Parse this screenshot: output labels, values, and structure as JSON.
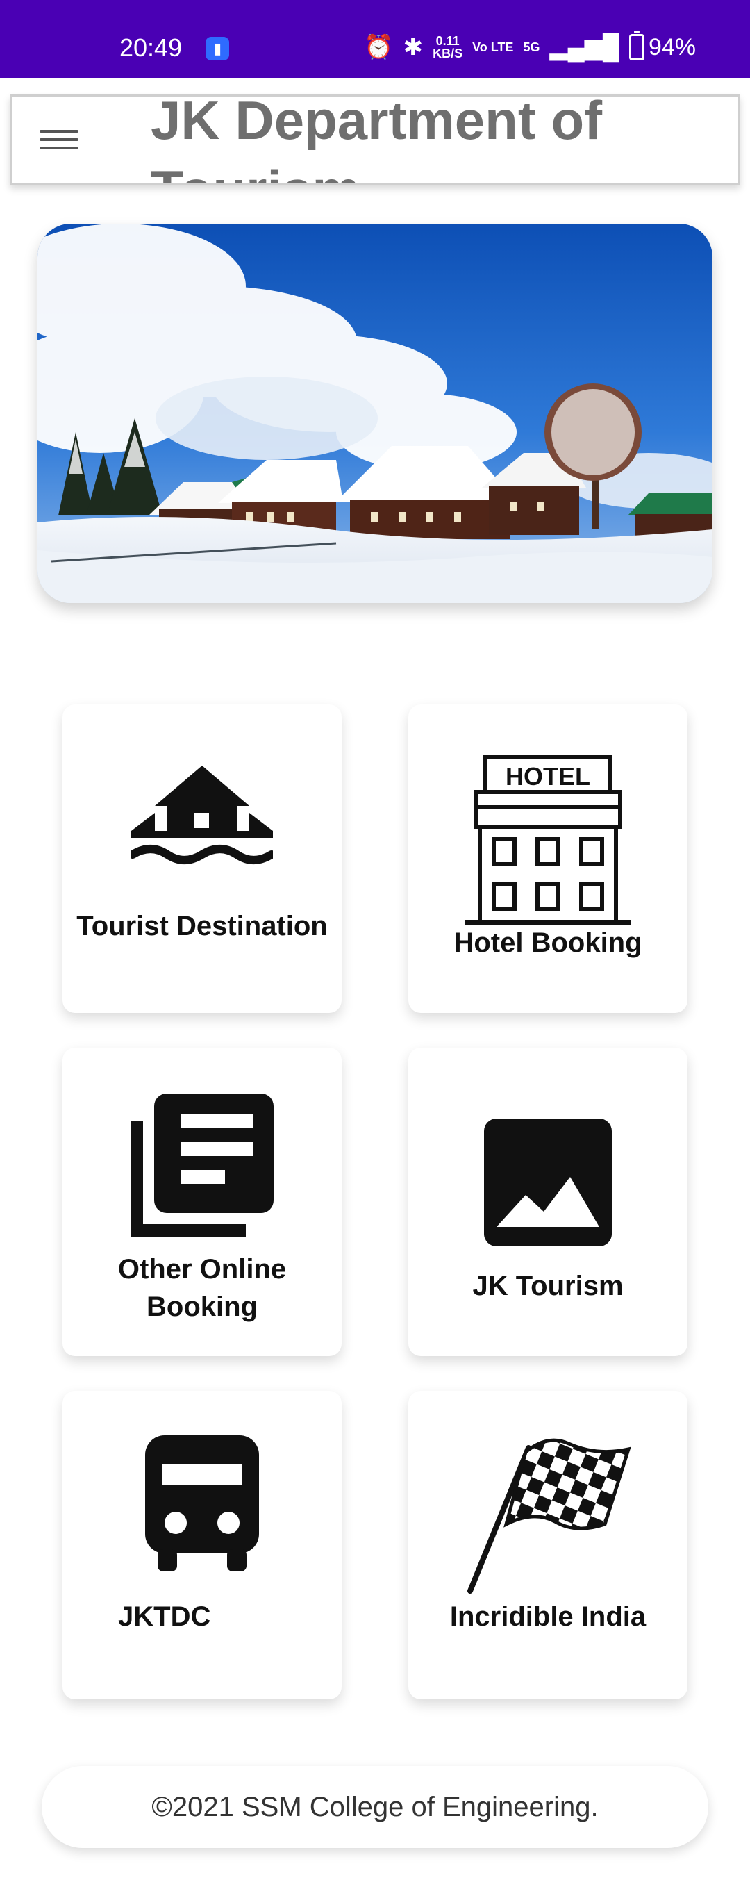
{
  "status_bar": {
    "time": "20:49",
    "network_speed_value": "0.11",
    "network_speed_unit": "KB/S",
    "volte": "Vo LTE",
    "network": "5G",
    "battery": "94%",
    "icons": [
      "app-notification-icon",
      "alarm-icon",
      "bluetooth-icon",
      "signal-icon",
      "battery-icon"
    ]
  },
  "header": {
    "title": "JK Department of Tourism",
    "menu_icon": "menu-icon"
  },
  "hero": {
    "image": "snowy-cabins-landscape"
  },
  "cards": [
    {
      "label": "Tourist Destination",
      "icon": "house-on-water-icon"
    },
    {
      "label": "Hotel Booking",
      "icon": "hotel-icon",
      "icon_text": "HOTEL"
    },
    {
      "label": "Other Online Booking",
      "icon": "library-books-icon"
    },
    {
      "label": "JK Tourism",
      "icon": "image-icon"
    },
    {
      "label": "JKTDC",
      "icon": "bus-icon"
    },
    {
      "label": "Incridible India",
      "icon": "checkered-flag-icon"
    }
  ],
  "footer": {
    "text": "©2021 SSM College of Engineering."
  },
  "colors": {
    "status_bar": "#4a00b4",
    "title_gray": "#6f6f6f",
    "icon_black": "#111111"
  }
}
